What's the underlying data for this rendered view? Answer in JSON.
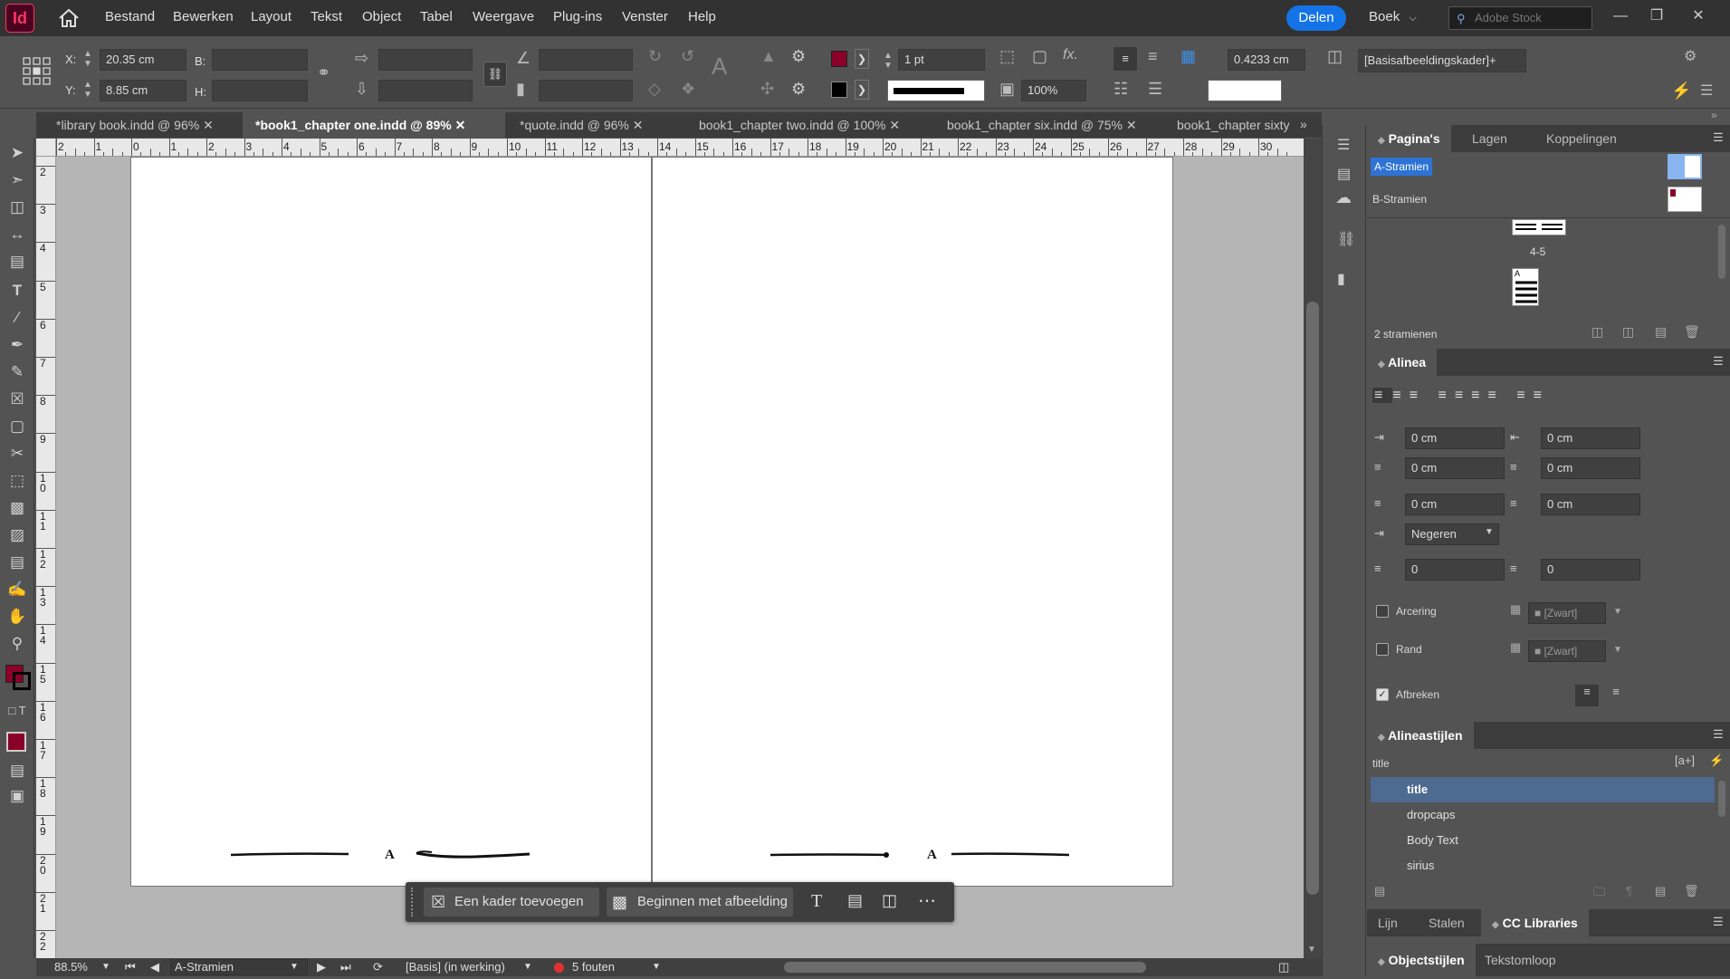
{
  "app": {
    "logo": "Id",
    "share_label": "Delen",
    "workspace": "Boek",
    "stock_placeholder": "Adobe Stock",
    "accent": "#1473e6",
    "brand": "#ff3366"
  },
  "menu": [
    "Bestand",
    "Bewerken",
    "Layout",
    "Tekst",
    "Object",
    "Tabel",
    "Weergave",
    "Plug-ins",
    "Venster",
    "Help"
  ],
  "control": {
    "x_label": "X:",
    "x_value": "20.35 cm",
    "y_label": "Y:",
    "y_value": "8.85 cm",
    "b_label": "B:",
    "h_label": "H:",
    "stroke_weight": "1 pt",
    "scale": "100%",
    "gap_value": "0.4233 cm",
    "frame_style": "[Basisafbeeldingskader]+",
    "fill_color": "#8b0029"
  },
  "tabs": [
    {
      "label": "*library book.indd @ 96%"
    },
    {
      "label": "*book1_chapter one.indd @ 89%"
    },
    {
      "label": "*quote.indd @ 96%"
    },
    {
      "label": "book1_chapter two.indd @ 100%"
    },
    {
      "label": "book1_chapter six.indd @ 75%"
    },
    {
      "label": "book1_chapter sixty"
    }
  ],
  "ruler": {
    "h_ticks": [
      "2",
      "1",
      "0",
      "1",
      "2",
      "3",
      "4",
      "5",
      "6",
      "7",
      "8",
      "9",
      "10",
      "11",
      "12",
      "13",
      "14",
      "15",
      "16",
      "17",
      "18",
      "19",
      "20",
      "21",
      "22",
      "23",
      "24",
      "25",
      "26",
      "27",
      "28",
      "29",
      "30"
    ],
    "v_ticks": [
      "2",
      "3",
      "4",
      "5",
      "6",
      "7",
      "8",
      "9",
      "1 0",
      "1 1",
      "1 2",
      "1 3",
      "1 4",
      "1 5",
      "1 6",
      "1 7",
      "1 8",
      "1 9",
      "2 0",
      "2 1",
      "2 2"
    ]
  },
  "page": {
    "footer_left_letter": "A",
    "footer_right_letter": "A"
  },
  "context_bar": {
    "add_frame": "Een kader toevoegen",
    "start_image": "Beginnen met afbeelding"
  },
  "status": {
    "zoom": "88.5%",
    "master": "A-Stramien",
    "profile": "[Basis] (in werking)",
    "errors": "5 fouten"
  },
  "pages_panel": {
    "tabs": [
      "Pagina's",
      "Lagen",
      "Koppelingen"
    ],
    "masters": [
      "A-Stramien",
      "B-Stramien"
    ],
    "spread_label": "4-5",
    "thumb_letter": "A",
    "footer": "2 stramienen"
  },
  "paragraph_panel": {
    "title": "Alinea",
    "left_indent": "0 cm",
    "right_indent": "0 cm",
    "first_line": "0 cm",
    "last_line": "0 cm",
    "space_before": "0 cm",
    "space_after": "0 cm",
    "align_grid": "Negeren",
    "dropcap_lines": "0",
    "dropcap_chars": "0",
    "shading_label": "Arcering",
    "shading_swatch": "[Zwart]",
    "border_label": "Rand",
    "border_swatch": "[Zwart]",
    "hyphenate_label": "Afbreken"
  },
  "styles_panel": {
    "title": "Alineastijlen",
    "current": "title",
    "items": [
      "title",
      "dropcaps",
      "Body Text",
      "sirius"
    ]
  },
  "bottom_tabs": [
    "Lijn",
    "Stalen",
    "CC Libraries"
  ],
  "bottom_tabs2": [
    "Objectstijlen",
    "Tekstomloop"
  ]
}
